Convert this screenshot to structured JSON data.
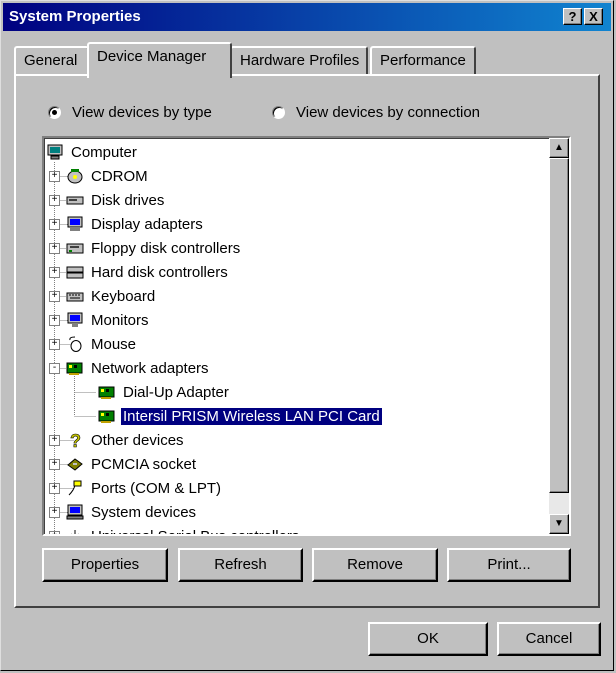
{
  "window": {
    "title": "System Properties",
    "help_button": "?",
    "close_button": "X"
  },
  "tabs": [
    {
      "label": "General"
    },
    {
      "label": "Device Manager"
    },
    {
      "label": "Hardware Profiles"
    },
    {
      "label": "Performance"
    }
  ],
  "view_options": {
    "by_type": {
      "label": "View devices by type",
      "selected": true
    },
    "by_connection": {
      "label": "View devices by connection",
      "selected": false
    }
  },
  "tree": {
    "root": {
      "label": "Computer",
      "icon": "computer-icon"
    },
    "items": [
      {
        "label": "CDROM",
        "icon": "cdrom-icon",
        "expander": "+"
      },
      {
        "label": "Disk drives",
        "icon": "disk-drive-icon",
        "expander": "+"
      },
      {
        "label": "Display adapters",
        "icon": "display-adapter-icon",
        "expander": "+"
      },
      {
        "label": "Floppy disk controllers",
        "icon": "floppy-controller-icon",
        "expander": "+"
      },
      {
        "label": "Hard disk controllers",
        "icon": "hard-disk-controller-icon",
        "expander": "+"
      },
      {
        "label": "Keyboard",
        "icon": "keyboard-icon",
        "expander": "+"
      },
      {
        "label": "Monitors",
        "icon": "monitor-icon",
        "expander": "+"
      },
      {
        "label": "Mouse",
        "icon": "mouse-icon",
        "expander": "+"
      },
      {
        "label": "Network adapters",
        "icon": "network-adapter-icon",
        "expander": "-"
      },
      {
        "label": "Dial-Up Adapter",
        "icon": "network-adapter-icon",
        "child": true
      },
      {
        "label": "Intersil PRISM Wireless LAN PCI Card",
        "icon": "network-adapter-icon",
        "child": true,
        "selected": true
      },
      {
        "label": "Other devices",
        "icon": "question-icon",
        "expander": "+"
      },
      {
        "label": "PCMCIA socket",
        "icon": "pcmcia-icon",
        "expander": "+"
      },
      {
        "label": "Ports (COM & LPT)",
        "icon": "port-icon",
        "expander": "+"
      },
      {
        "label": "System devices",
        "icon": "system-device-icon",
        "expander": "+"
      },
      {
        "label": "Universal Serial Bus controllers",
        "icon": "usb-icon",
        "expander": "+"
      }
    ]
  },
  "buttons": {
    "properties": "Properties",
    "refresh": "Refresh",
    "remove": "Remove",
    "print": "Print...",
    "ok": "OK",
    "cancel": "Cancel"
  },
  "colors": {
    "title_start": "#000080",
    "title_end": "#1084d0",
    "face": "#c0c0c0",
    "selection": "#000080"
  }
}
